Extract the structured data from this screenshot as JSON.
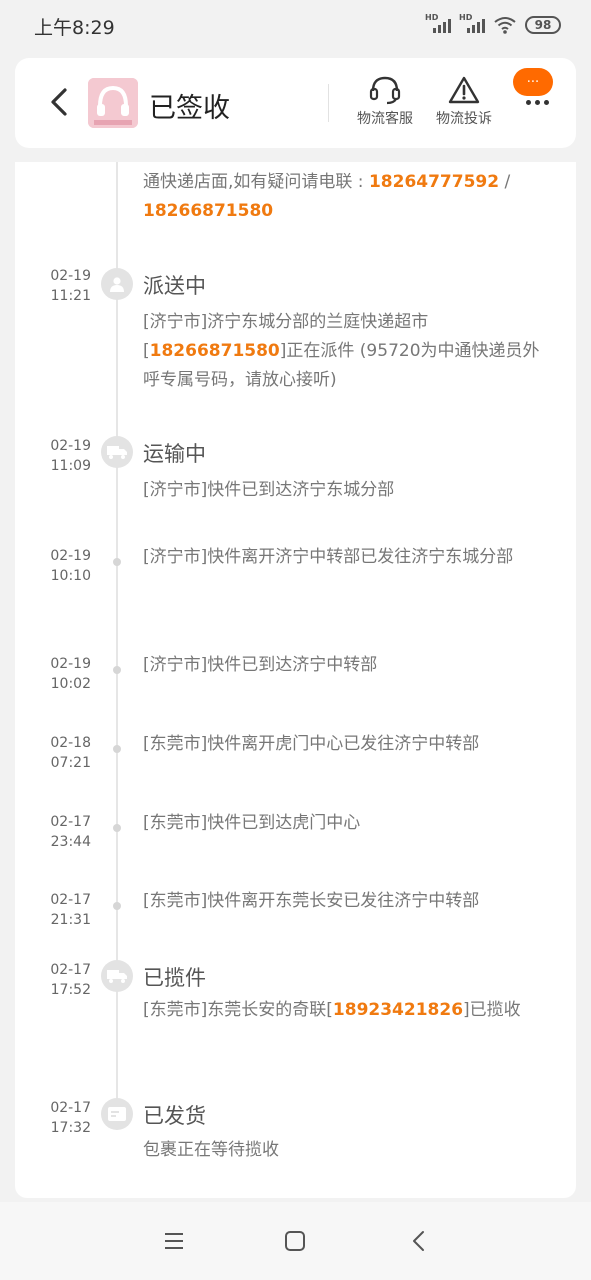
{
  "status_bar": {
    "time": "上午8:29",
    "signal1_label": "HD",
    "signal2_label": "HD",
    "battery": "98"
  },
  "header": {
    "title": "已签收",
    "back_icon": "chevron-left-icon",
    "avatar_icon": "headphones-product-thumbnail",
    "service_label": "物流客服",
    "service_icon": "headset-icon",
    "complaint_label": "物流投诉",
    "complaint_icon": "warning-triangle-icon",
    "more_icon": "more-dots-icon",
    "bubble_text": "···"
  },
  "timeline": {
    "top_entry": {
      "text": "通快递店面,如有疑问请电联 : ",
      "phone1": "18264777592",
      "sep": " / ",
      "phone2": "18266871580"
    },
    "entries": [
      {
        "date": "02-19",
        "time": "11:21",
        "status": "派送中",
        "icon": "person-icon",
        "pre": "[济宁市]济宁东城分部的兰庭快递超市[",
        "phone": "18266871580",
        "post": "]正在派件 (95720为中通快递员外呼专属号码，请放心接听)"
      },
      {
        "date": "02-19",
        "time": "11:09",
        "status": "运输中",
        "icon": "truck-icon",
        "text": "[济宁市]快件已到达济宁东城分部"
      },
      {
        "date": "02-19",
        "time": "10:10",
        "text": "[济宁市]快件离开济宁中转部已发往济宁东城分部"
      },
      {
        "date": "02-19",
        "time": "10:02",
        "text": "[济宁市]快件已到达济宁中转部"
      },
      {
        "date": "02-18",
        "time": "07:21",
        "text": "[东莞市]快件离开虎门中心已发往济宁中转部"
      },
      {
        "date": "02-17",
        "time": "23:44",
        "text": "[东莞市]快件已到达虎门中心"
      },
      {
        "date": "02-17",
        "time": "21:31",
        "text": "[东莞市]快件离开东莞长安已发往济宁中转部"
      },
      {
        "date": "02-17",
        "time": "17:52",
        "status": "已揽件",
        "icon": "pickup-truck-icon",
        "pre": "[东莞市]东莞长安的奇联[",
        "phone": "18923421826",
        "post": "]已揽收"
      },
      {
        "date": "02-17",
        "time": "17:32",
        "status": "已发货",
        "icon": "package-icon",
        "text": "包裹正在等待揽收"
      }
    ]
  },
  "nav": {
    "menu_icon": "menu-icon",
    "home_icon": "home-square-icon",
    "back_icon": "back-triangle-icon"
  },
  "colors": {
    "accent": "#f07a10",
    "bubble": "#ff6a00",
    "background": "#f2f2f2"
  }
}
